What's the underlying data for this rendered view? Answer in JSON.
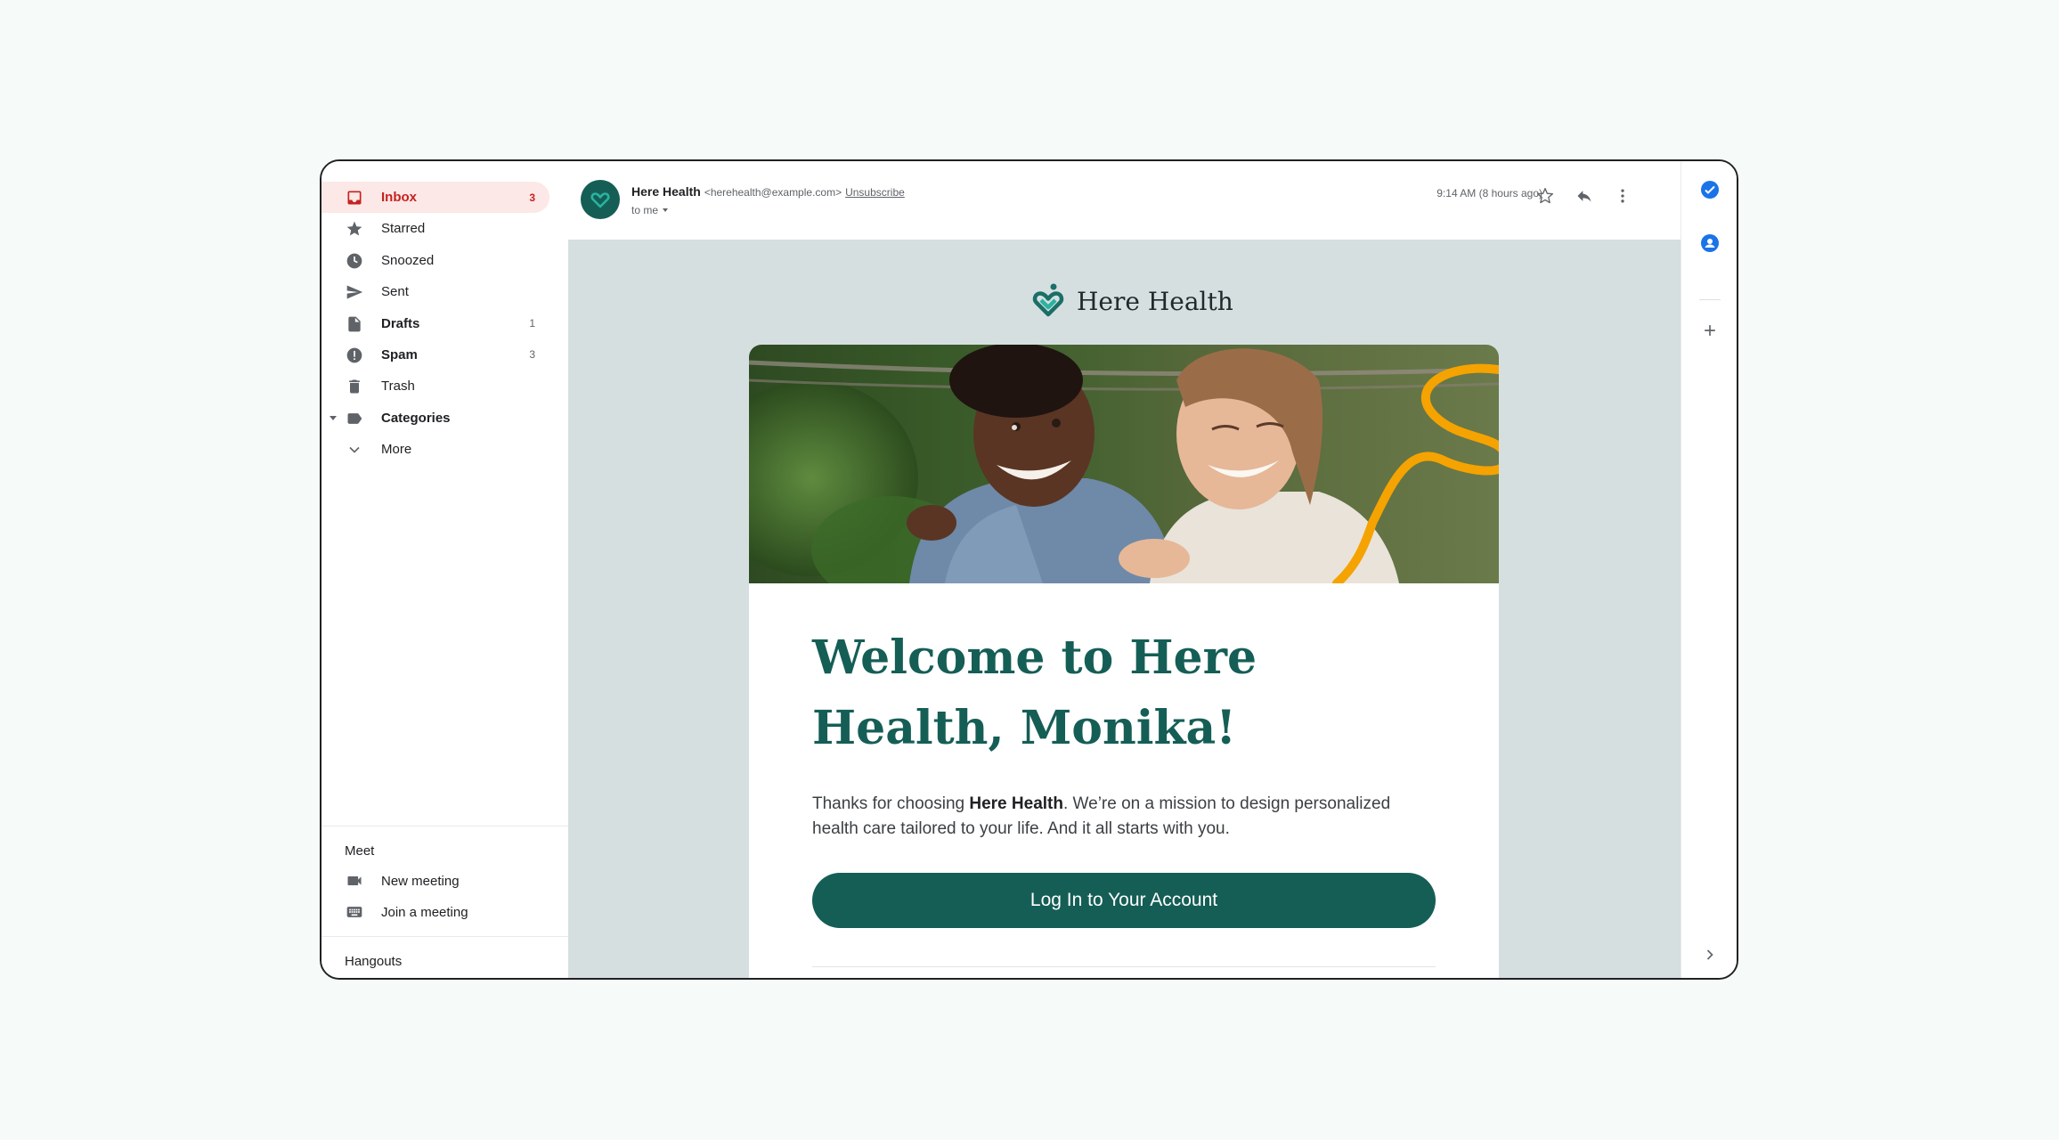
{
  "nav": {
    "items": [
      {
        "label": "Inbox",
        "count": "3",
        "icon": "inbox-icon"
      },
      {
        "label": "Starred",
        "count": "",
        "icon": "star-icon"
      },
      {
        "label": "Snoozed",
        "count": "",
        "icon": "clock-icon"
      },
      {
        "label": "Sent",
        "count": "",
        "icon": "send-icon"
      },
      {
        "label": "Drafts",
        "count": "1",
        "icon": "draft-icon"
      },
      {
        "label": "Spam",
        "count": "3",
        "icon": "spam-icon"
      },
      {
        "label": "Trash",
        "count": "",
        "icon": "trash-icon"
      },
      {
        "label": "Categories",
        "count": "",
        "icon": "label-icon"
      },
      {
        "label": "More",
        "count": "",
        "icon": "chevron-down-icon"
      }
    ],
    "meet": {
      "title": "Meet",
      "new_meeting": "New meeting",
      "join_meeting": "Join a meeting"
    },
    "hangouts": {
      "title": "Hangouts"
    }
  },
  "email": {
    "sender_name": "Here Health",
    "sender_email": "<herehealth@example.com>",
    "unsubscribe": "Unsubscribe",
    "to": "to me",
    "timestamp": "9:14 AM (8 hours ago)",
    "brand_name": "Here Health",
    "headline": "Welcome to Here Health, Monika!",
    "body_prefix": "Thanks for choosing ",
    "body_bold": "Here Health",
    "body_suffix": ". We’re on a mission to design personalized health care tailored to your life. And it all starts with you.",
    "cta_label": "Log In to Your Account"
  },
  "colors": {
    "brand_green": "#155e56",
    "inbox_red": "#c5221f",
    "accent_orange": "#f5a300",
    "email_background": "#d6dfe0"
  }
}
